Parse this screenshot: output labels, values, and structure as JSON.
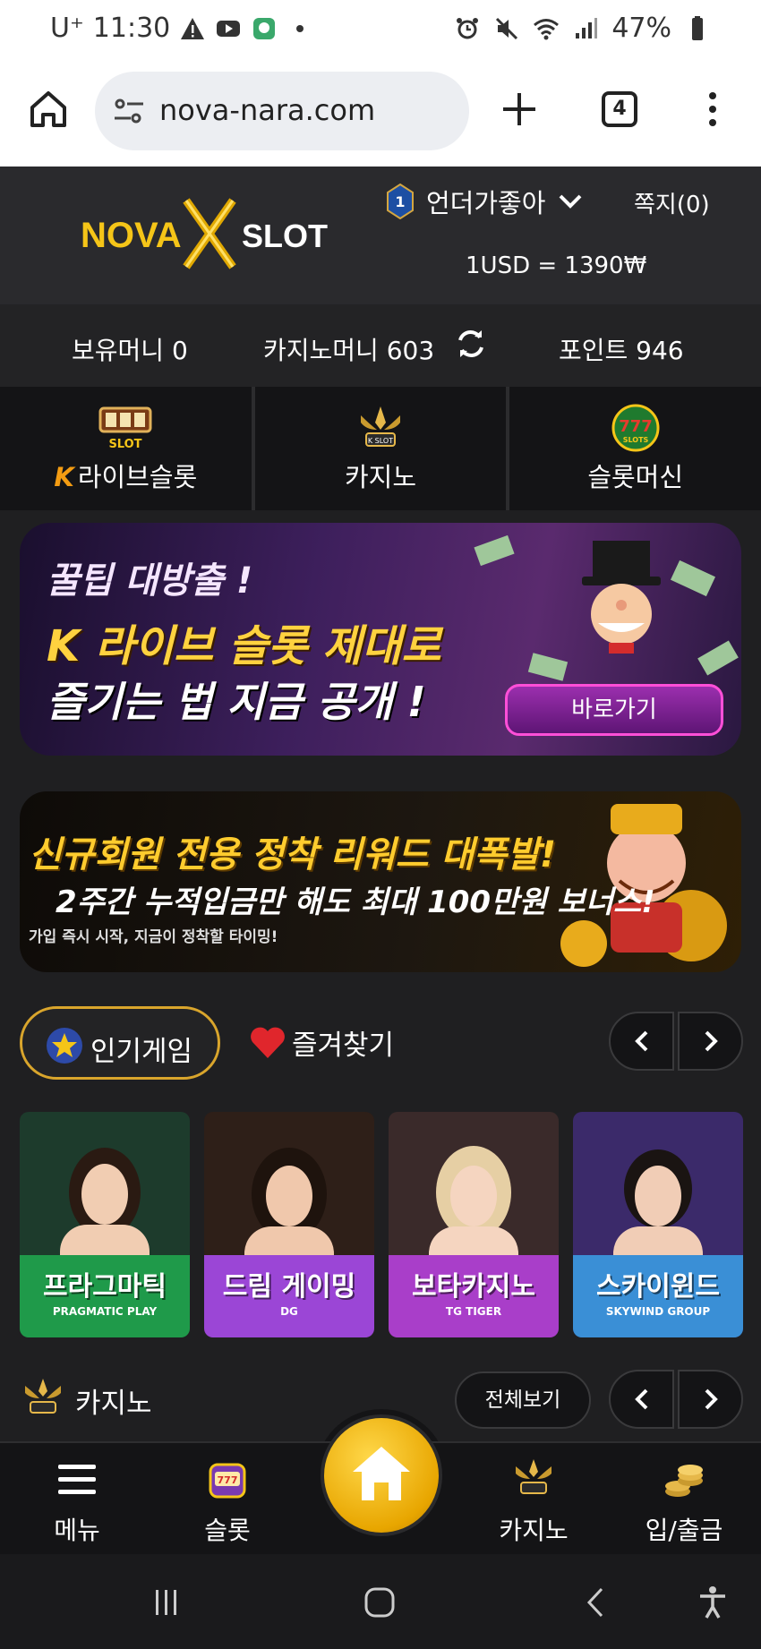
{
  "status_bar": {
    "carrier": "U⁺",
    "time": "11:30",
    "battery": "47%"
  },
  "browser": {
    "url": "nova-nara.com",
    "tab_count": "4"
  },
  "header": {
    "logo_text_1": "NOVA",
    "logo_text_2": "SLOT",
    "level": "1",
    "username": "언더가좋아",
    "messages": "쪽지(0)",
    "exchange_rate": "1USD = 1390₩"
  },
  "balances": {
    "holding_money": "보유머니 0",
    "casino_money": "카지노머니 603",
    "points": "포인트 946"
  },
  "categories": [
    {
      "label": "라이브슬롯",
      "prefix": "K"
    },
    {
      "label": "카지노"
    },
    {
      "label": "슬롯머신"
    }
  ],
  "banner1": {
    "line1": "꿀팁 대방출 !",
    "line2": "K 라이브 슬롯 제대로",
    "line3": "즐기는 법 지금 공개 !",
    "button": "바로가기"
  },
  "banner2": {
    "line1": "신규회원 전용 정착 리워드 대폭발!",
    "line2": "2주간 누적입금만 해도 최대 100만원 보너스!",
    "line3": "가입 즉시 시작, 지금이 정착할 타이밍!"
  },
  "game_tabs": {
    "popular": "인기게임",
    "favorites": "즐겨찾기"
  },
  "game_cards": [
    {
      "title": "프라그마틱",
      "brand": "PRAGMATIC PLAY",
      "color": "#1f9a4a"
    },
    {
      "title": "드림 게이밍",
      "brand": "DG",
      "color": "#9b46d6"
    },
    {
      "title": "보타카지노",
      "brand": "TG TIGER",
      "color": "#a93ec9"
    },
    {
      "title": "스카이윈드",
      "brand": "SKYWIND GROUP",
      "color": "#3a8fd6"
    }
  ],
  "casino_section": {
    "title": "카지노",
    "view_all": "전체보기"
  },
  "bottom_nav": {
    "menu": "메뉴",
    "slot": "슬롯",
    "casino": "카지노",
    "deposit": "입/출금"
  }
}
